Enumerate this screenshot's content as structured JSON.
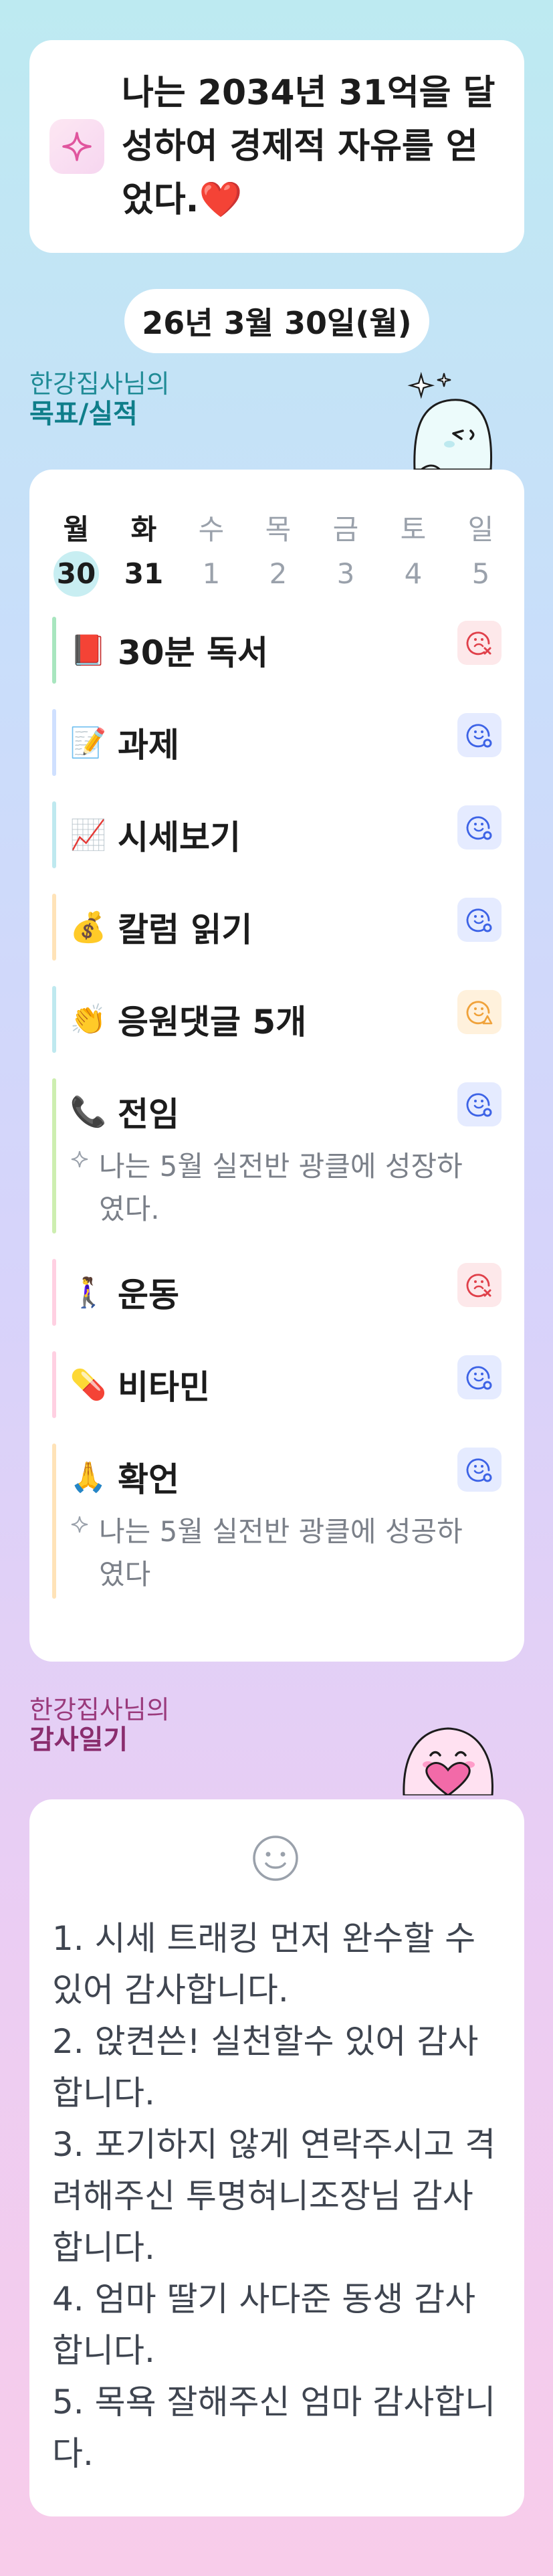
{
  "goal": {
    "text": "나는 2034년 31억을 달성하여 경제적 자유를 얻었다.",
    "heart": "❤️",
    "icon": "sparkle-icon"
  },
  "date_label": "26년 3월 30일(월)",
  "goals_section": {
    "sub": "한강집사님의",
    "main": "목표/실적"
  },
  "week": {
    "days": [
      {
        "name": "월",
        "num": "30"
      },
      {
        "name": "화",
        "num": "31"
      },
      {
        "name": "수",
        "num": "1"
      },
      {
        "name": "목",
        "num": "2"
      },
      {
        "name": "금",
        "num": "3"
      },
      {
        "name": "토",
        "num": "4"
      },
      {
        "name": "일",
        "num": "5"
      }
    ]
  },
  "tasks": [
    {
      "emoji": "📕",
      "title": "30분 독서",
      "status": "fail",
      "bar": "#a8e6bf"
    },
    {
      "emoji": "📝",
      "title": "과제",
      "status": "done",
      "bar": "#cfe0ff"
    },
    {
      "emoji": "📈",
      "title": "시세보기",
      "status": "done",
      "bar": "#bfe9ef"
    },
    {
      "emoji": "💰",
      "title": "칼럼 읽기",
      "status": "done",
      "bar": "#ffe3b8"
    },
    {
      "emoji": "👏",
      "title": "응원댓글 5개",
      "status": "warn",
      "bar": "#bfe9ef"
    },
    {
      "emoji": "📞",
      "title": "전임",
      "status": "done",
      "bar": "#cdeeb0",
      "note": "나는 5월 실전반 광클에 성장하였다."
    },
    {
      "emoji": "🚶‍♀️",
      "title": "운동",
      "status": "fail",
      "bar": "#ffd0e2"
    },
    {
      "emoji": "💊",
      "title": "비타민",
      "status": "done",
      "bar": "#ffd0e2"
    },
    {
      "emoji": "🙏",
      "title": "확언",
      "status": "done",
      "bar": "#ffe3b8",
      "note": "나는 5월 실전반 광클에 성공하였다"
    }
  ],
  "gratitude_section": {
    "sub": "한강집사님의",
    "main": "감사일기"
  },
  "gratitude": {
    "icon": "smile-icon",
    "text": "1. 시세 트래킹 먼저 완수할 수 있어 감사합니다.\n2. 앉켠쓴! 실천할수 있어 감사합니다.\n3. 포기하지 않게 연락주시고 격려해주신 투명혀니조장님 감사합니다.\n4. 엄마 딸기 사다준 동생 감사합니다.\n5. 목욕 잘해주신 엄마 감사합니다."
  },
  "colors": {
    "teal": "#0f7e8a",
    "plum": "#8a2d6e",
    "fail": "#e0404a",
    "done": "#3d63e6",
    "warn": "#f0a23a"
  }
}
